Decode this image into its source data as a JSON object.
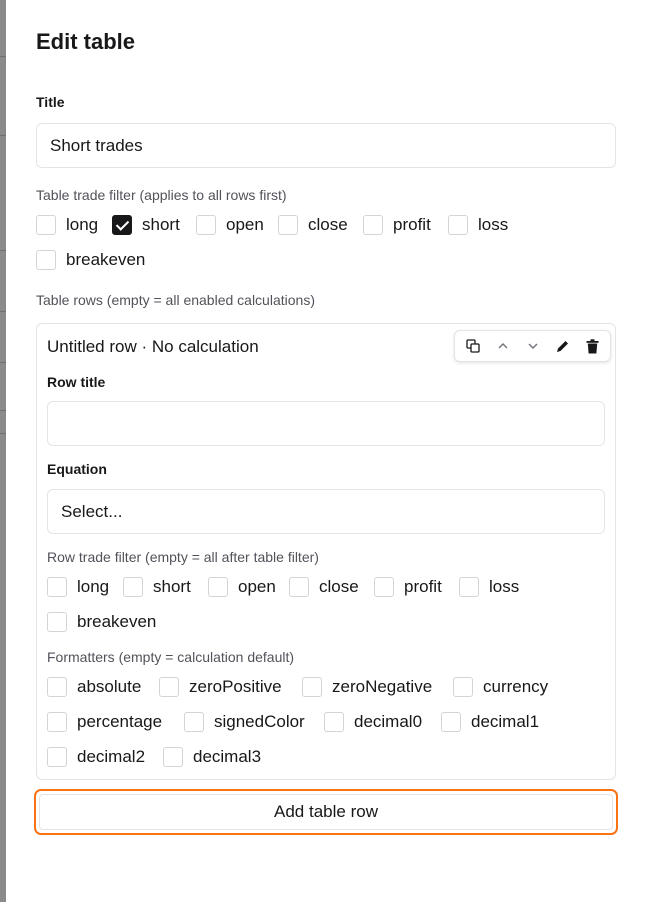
{
  "dialog": {
    "title": "Edit table",
    "title_field": {
      "label": "Title",
      "value": "Short trades"
    },
    "table_filter": {
      "hint": "Table trade filter (applies to all rows first)",
      "options": [
        {
          "label": "long",
          "checked": false
        },
        {
          "label": "short",
          "checked": true
        },
        {
          "label": "open",
          "checked": false
        },
        {
          "label": "close",
          "checked": false
        },
        {
          "label": "profit",
          "checked": false
        },
        {
          "label": "loss",
          "checked": false
        },
        {
          "label": "breakeven",
          "checked": false
        }
      ]
    },
    "rows_hint": "Table rows (empty = all enabled calculations)",
    "row": {
      "heading": "Untitled row · No calculation",
      "row_title": {
        "label": "Row title",
        "value": ""
      },
      "equation": {
        "label": "Equation",
        "value": "Select..."
      },
      "row_filter": {
        "hint": "Row trade filter (empty = all after table filter)",
        "options": [
          {
            "label": "long",
            "checked": false
          },
          {
            "label": "short",
            "checked": false
          },
          {
            "label": "open",
            "checked": false
          },
          {
            "label": "close",
            "checked": false
          },
          {
            "label": "profit",
            "checked": false
          },
          {
            "label": "loss",
            "checked": false
          },
          {
            "label": "breakeven",
            "checked": false
          }
        ]
      },
      "formatters": {
        "hint": "Formatters (empty = calculation default)",
        "options": [
          {
            "label": "absolute",
            "checked": false
          },
          {
            "label": "zeroPositive",
            "checked": false
          },
          {
            "label": "zeroNegative",
            "checked": false
          },
          {
            "label": "currency",
            "checked": false
          },
          {
            "label": "percentage",
            "checked": false
          },
          {
            "label": "signedColor",
            "checked": false
          },
          {
            "label": "decimal0",
            "checked": false
          },
          {
            "label": "decimal1",
            "checked": false
          },
          {
            "label": "decimal2",
            "checked": false
          },
          {
            "label": "decimal3",
            "checked": false
          }
        ]
      },
      "toolbar_icons": [
        "duplicate-icon",
        "move-up-icon",
        "move-down-icon",
        "edit-icon",
        "delete-icon"
      ]
    },
    "add_row_label": "Add table row"
  },
  "colors": {
    "accent_focus": "#f97316",
    "checked": "#18181b",
    "border": "#e4e4e7"
  }
}
